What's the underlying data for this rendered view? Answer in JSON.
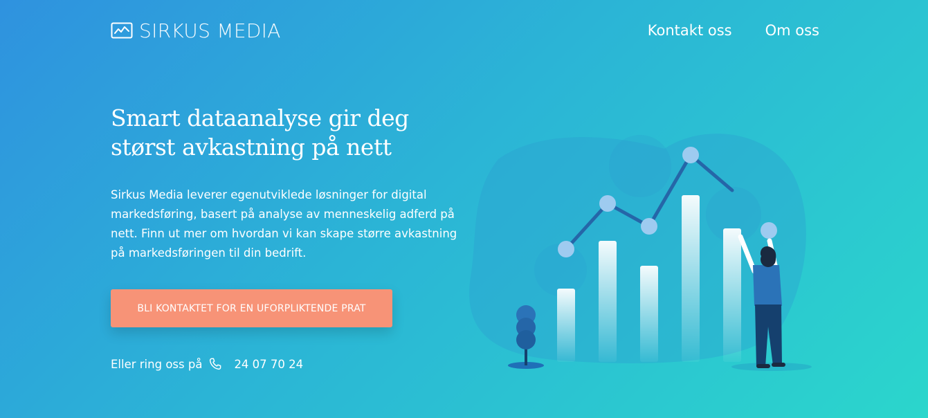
{
  "header": {
    "logo_text": "SIRKUS MEDIA",
    "logo_icon": "line-chart-icon",
    "nav": [
      {
        "label": "Kontakt oss"
      },
      {
        "label": "Om oss"
      }
    ]
  },
  "hero": {
    "title": "Smart dataanalyse gir deg størst avkastning på nett",
    "description": "Sirkus Media leverer egenutviklede løsninger for digital markedsføring, basert på analyse av menneskelig adferd på nett. Finn ut mer om hvordan vi kan skape større avkastning på markedsføringen til din bedrift.",
    "cta_label": "BLI KONTAKTET FOR EN UFORPLIKTENDE PRAT",
    "call_text": "Eller ring oss på",
    "phone_icon": "phone-icon",
    "phone_number": "24 07 70 24"
  },
  "colors": {
    "gradient_start": "#2f92df",
    "gradient_end": "#2bd6cc",
    "cta": "#f79377",
    "chart_line": "#2566a8",
    "chart_dot": "#9ecbf0",
    "person_shirt": "#2b73b8",
    "person_pants": "#15406e"
  }
}
